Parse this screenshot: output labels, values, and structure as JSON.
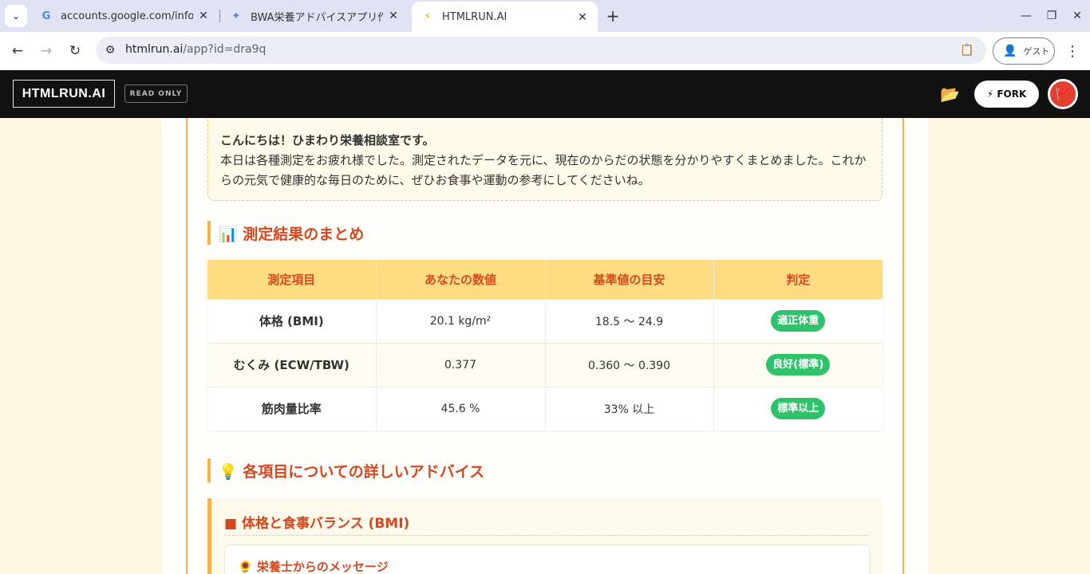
{
  "browser": {
    "tabs": [
      {
        "title": "accounts.google.com/info/se",
        "icon": "google-g-icon",
        "active": false
      },
      {
        "title": "BWA栄養アドバイスアプリ作",
        "icon": "gemini-icon",
        "active": false
      },
      {
        "title": "HTMLRUN.AI",
        "icon": "lightning-icon",
        "active": true
      }
    ],
    "url_host": "htmlrun.ai",
    "url_path": "/app?id=dra9q",
    "guest_label": "ゲスト"
  },
  "app": {
    "logo": "HTMLRUN.AI",
    "readonly_badge": "READ ONLY",
    "fork_label": "⚡ FORK"
  },
  "greeting": {
    "hello": "こんにちは！ひまわり栄養相談室です。",
    "body": "本日は各種測定をお疲れ様でした。測定されたデータを元に、現在のからだの状態を分かりやすくまとめました。これからの元気で健康的な毎日のために、ぜひお食事や運動の参考にしてくださいね。"
  },
  "summary": {
    "heading": "📊 測定結果のまとめ",
    "headers": [
      "測定項目",
      "あなたの数値",
      "基準値の目安",
      "判定"
    ],
    "rows": [
      {
        "item": "体格 (BMI)",
        "value": "20.1 kg/m²",
        "range": "18.5 〜 24.9",
        "judge": "適正体重"
      },
      {
        "item": "むくみ (ECW/TBW)",
        "value": "0.377",
        "range": "0.360 〜 0.390",
        "judge": "良好(標準)"
      },
      {
        "item": "筋肉量比率",
        "value": "45.6 %",
        "range": "33% 以上",
        "judge": "標準以上"
      }
    ],
    "badge_color": "#2ec36b"
  },
  "advice": {
    "heading": "💡 各項目についての詳しいアドバイス",
    "subheading": "■ 体格と食事バランス (BMI)",
    "message_title": "🌻 栄養士からのメッセージ"
  },
  "colors": {
    "accent": "#d4481f",
    "border": "#f3b24a",
    "header_fill": "#fedd82"
  }
}
